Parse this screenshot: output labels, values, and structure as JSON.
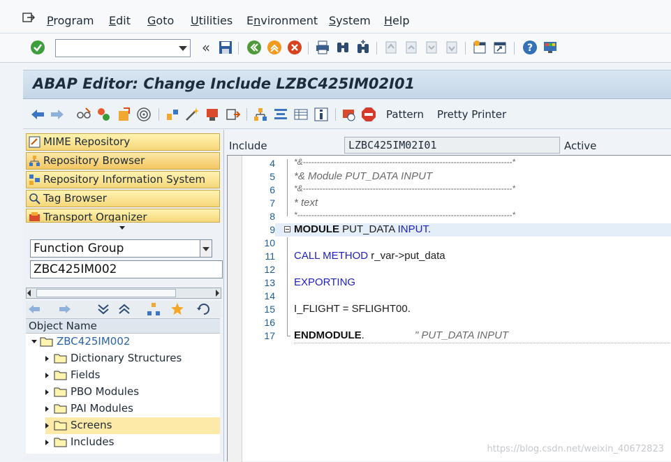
{
  "menu": {
    "items": [
      {
        "label": "Program",
        "u": "P",
        "rest": "rogram"
      },
      {
        "label": "Edit",
        "u": "E",
        "rest": "dit"
      },
      {
        "label": "Goto",
        "u": "G",
        "rest": "oto"
      },
      {
        "label": "Utilities",
        "u": "U",
        "rest": "tilities"
      },
      {
        "label": "Environment",
        "pre": "E",
        "u": "n",
        "rest": "vironment"
      },
      {
        "label": "System",
        "pre": "",
        "u": "S",
        "rest": "ystem"
      },
      {
        "label": "Help",
        "u": "H",
        "rest": "elp"
      }
    ]
  },
  "toolbar": {
    "command_field_value": "",
    "nav_symbol": "«"
  },
  "title": "ABAP Editor: Change Include LZBC425IM02I01",
  "app_toolbar": {
    "pattern_label": "Pattern",
    "pretty_printer_label": "Pretty Printer"
  },
  "nav": {
    "buttons": [
      "MIME Repository",
      "Repository Browser",
      "Repository Information System",
      "Tag Browser",
      "Transport Organizer"
    ],
    "object_type": "Function Group",
    "object_name": "ZBC425IM002",
    "tree_header": "Object Name",
    "tree": {
      "root": "ZBC425IM002",
      "children": [
        "Dictionary Structures",
        "Fields",
        "PBO Modules",
        "PAI Modules",
        "Screens",
        "Includes"
      ]
    }
  },
  "editor": {
    "include_label": "Include",
    "include_name": "LZBC425IM02I01",
    "status": "Active",
    "line_numbers": [
      "4",
      "5",
      "6",
      "7",
      "8",
      "9",
      "10",
      "11",
      "12",
      "13",
      "14",
      "15",
      "16",
      "17"
    ],
    "lines": {
      "l4": "*&---------------------------------------------------------------------------*",
      "l5": "*&     Module  PUT_DATA  INPUT",
      "l6": "*&---------------------------------------------------------------------------*",
      "l7": "*       text",
      "l8": "*-----------------------------------------------------------------------------*",
      "l9_kw": "MODULE",
      "l9_rest": " PUT_DATA ",
      "l9_kw2": "INPUT.",
      "l11_kw": "CALL METHOD",
      "l11_rest": " r_var->put_data",
      "l13_kw": "EXPORTING",
      "l15": "I_FLIGHT = SFLIGHT00.",
      "l17_kw": "ENDMODULE",
      "l17_dot": ".",
      "l17_cmt": "\" PUT_DATA  INPUT"
    }
  },
  "watermark": "https://blog.csdn.net/weixin_40672823",
  "colors": {
    "keyword": "#2020c0",
    "comment": "#6a6a6a",
    "line_number": "#1a5d99",
    "title_bg": "#c4d6e8"
  }
}
